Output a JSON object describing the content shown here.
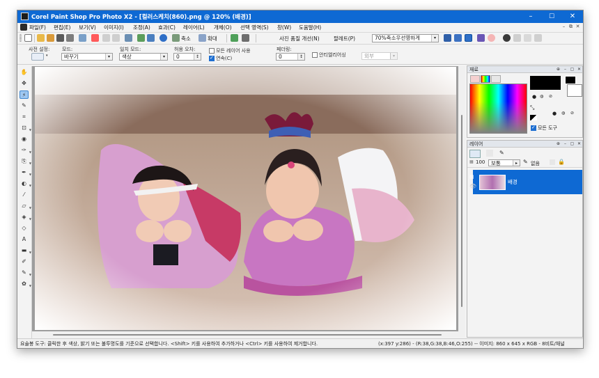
{
  "window": {
    "title": "Corel Paint Shop Pro Photo X2 - [컬러스케치(860).png @ 120% (배경)]",
    "minimize": "–",
    "maximize": "☐",
    "close": "✕"
  },
  "menu": {
    "items": [
      "파일(F)",
      "편집(E)",
      "보기(V)",
      "이미지(I)",
      "조정(A)",
      "효과(C)",
      "레이어(L)",
      "개체(O)",
      "선택 영역(S)",
      "창(W)",
      "도움말(H)"
    ],
    "mdi_minimize": "–",
    "mdi_restore": "⧉",
    "mdi_close": "✕"
  },
  "toolbar": {
    "shrink_label": "축소",
    "enlarge_label": "확대",
    "photo_quality_label": "사진 품질 개선(N)",
    "palette_label": "팔레트(P)",
    "zoom_combo": "70%축소우선영하게"
  },
  "tool_options": {
    "preset_label": "사전 설정:",
    "mode_label": "모드:",
    "mode_value": "바꾸기",
    "match_mode_label": "일치 모드:",
    "match_mode_value": "색상",
    "tolerance_label": "허용 오차:",
    "tolerance_value": "0",
    "use_all_layers_label": "모든 레이어 사용",
    "contiguous_label": "연속(C)",
    "feather_label": "페더링:",
    "feather_value": "0",
    "antialias_label": "안티엘리어싱",
    "antialias_value": "외부"
  },
  "materials_panel": {
    "title": "재료",
    "all_tools_label": "모든 도구",
    "foreground_color": "#000000",
    "background_color": "#ffffff"
  },
  "layers_panel": {
    "title": "레이어",
    "opacity_value": "100",
    "blend_mode": "보통",
    "none_label": "없음",
    "layers": [
      {
        "name": "배경",
        "selected": true
      }
    ]
  },
  "status_bar": {
    "hint": "요술봉 도구: 클릭한 후 색상, 밝기 또는 불투명도를 기준으로 선택합니다. <Shift> 키를 사용하여 추가하거나 <Ctrl> 키를 사용하여 제거합니다.",
    "info": "(x:397 y:286) - (R:38,G:38,B:46,O:255) -- 이미지:  860 x 645 x RGB - 8비트/채널"
  },
  "colors": {
    "titlebar": "#0e69d3",
    "selection": "#0e69d3",
    "frame": "#f3f3f3"
  }
}
